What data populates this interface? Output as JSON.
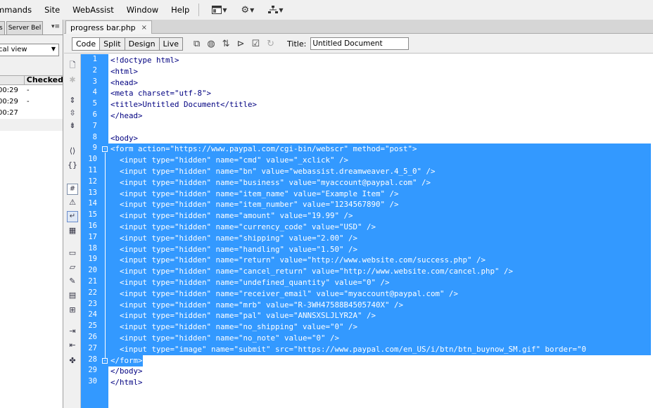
{
  "menubar": {
    "items": [
      "ommands",
      "Site",
      "WebAssist",
      "Window",
      "Help"
    ]
  },
  "left_panel": {
    "tabs": [
      "s",
      "Server Bel"
    ],
    "select_value": "cal view",
    "column_header": "Checked",
    "rows": [
      {
        "time": "00:29",
        "checked": "-"
      },
      {
        "time": "00:29",
        "checked": "-"
      },
      {
        "time": "00:27",
        "checked": ""
      }
    ]
  },
  "document": {
    "tab_label": "progress bar.php",
    "close_glyph": "×",
    "view_buttons": [
      "Code",
      "Split",
      "Design",
      "Live"
    ],
    "title_label": "Title:",
    "title_value": "Untitled Document"
  },
  "code": {
    "lines": [
      "<!doctype html>",
      "<html>",
      "<head>",
      "<meta charset=\"utf-8\">",
      "<title>Untitled Document</title>",
      "</head>",
      "",
      "<body>",
      "<form action=\"https://www.paypal.com/cgi-bin/webscr\" method=\"post\">",
      "  <input type=\"hidden\" name=\"cmd\" value=\"_xclick\" />",
      "  <input type=\"hidden\" name=\"bn\" value=\"webassist.dreamweaver.4_5_0\" />",
      "  <input type=\"hidden\" name=\"business\" value=\"myaccount@paypal.com\" />",
      "  <input type=\"hidden\" name=\"item_name\" value=\"Example Item\" />",
      "  <input type=\"hidden\" name=\"item_number\" value=\"1234567890\" />",
      "  <input type=\"hidden\" name=\"amount\" value=\"19.99\" />",
      "  <input type=\"hidden\" name=\"currency_code\" value=\"USD\" />",
      "  <input type=\"hidden\" name=\"shipping\" value=\"2.00\" />",
      "  <input type=\"hidden\" name=\"handling\" value=\"1.50\" />",
      "  <input type=\"hidden\" name=\"return\" value=\"http://www.website.com/success.php\" />",
      "  <input type=\"hidden\" name=\"cancel_return\" value=\"http://www.website.com/cancel.php\" />",
      "  <input type=\"hidden\" name=\"undefined_quantity\" value=\"0\" />",
      "  <input type=\"hidden\" name=\"receiver_email\" value=\"myaccount@paypal.com\" />",
      "  <input type=\"hidden\" name=\"mrb\" value=\"R-3WH47588B4505740X\" />",
      "  <input type=\"hidden\" name=\"pal\" value=\"ANNSXSLJLYR2A\" />",
      "  <input type=\"hidden\" name=\"no_shipping\" value=\"0\" />",
      "  <input type=\"hidden\" name=\"no_note\" value=\"0\" />",
      "  <input type=\"image\" name=\"submit\" src=\"https://www.paypal.com/en_US/i/btn/btn_buynow_SM.gif\" border=\"0",
      "</form>",
      "</body>",
      "</html>"
    ]
  }
}
